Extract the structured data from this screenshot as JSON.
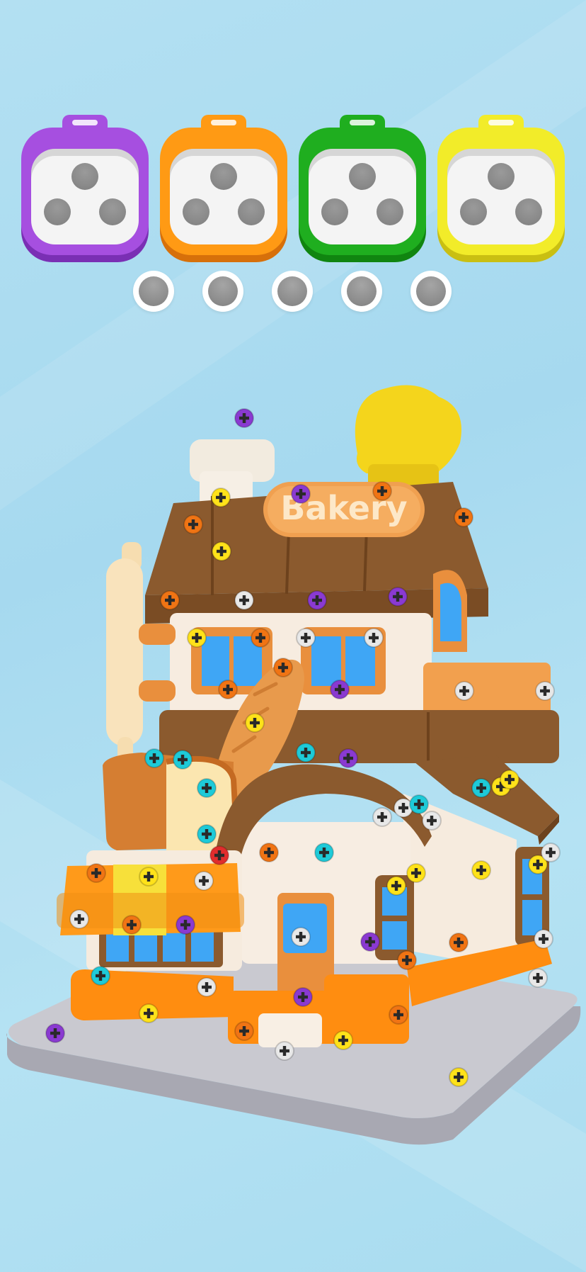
{
  "toolboxes": [
    {
      "color": "#a64fe0",
      "dark": "#7a2fb4",
      "slots": 3
    },
    {
      "color": "#ff9a14",
      "dark": "#d7700a",
      "slots": 3
    },
    {
      "color": "#1fae1f",
      "dark": "#108510",
      "slots": 3
    },
    {
      "color": "#f2ec29",
      "dark": "#c9bf12",
      "slots": 3
    }
  ],
  "holding_slots": 5,
  "building": {
    "sign_text": "Bakery"
  },
  "screw_colors": {
    "purple": "#8a3ad1",
    "orange": "#f07414",
    "yellow": "#ffe21a",
    "cyan": "#1ecad8",
    "white": "#e8e8e8",
    "red": "#e02d2d"
  }
}
